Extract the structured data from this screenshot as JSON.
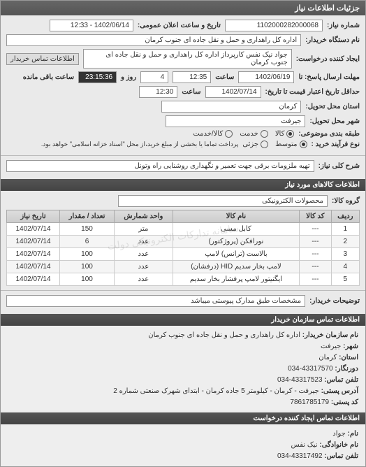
{
  "header": {
    "title": "جزئیات اطلاعات نیاز"
  },
  "top": {
    "reqNumLabel": "شماره نیاز:",
    "reqNum": "1102000282000068",
    "announceLabel": "تاریخ و ساعت اعلان عمومی:",
    "announceVal": "1402/06/14 - 12:33",
    "buyerLabel": "نام دستگاه خریدار:",
    "buyerVal": "اداره کل راهداری و حمل و نقل جاده ای جنوب کرمان",
    "creatorLabel": "ایجاد کننده درخواست:",
    "creatorVal": "جواد  نیک نفس کارپرداز اداره کل راهداری و حمل و نقل جاده ای جنوب کرمان",
    "contactBtn": "اطلاعات تماس خریدار",
    "deadlineSendLabel": "مهلت ارسال پاسخ: تا",
    "deadlineSendDate": "1402/06/19",
    "timeLabel1": "ساعت",
    "deadlineSendTime": "12:35",
    "daysLabel": "روز و",
    "daysVal": "4",
    "remainLabel": "ساعت باقی مانده",
    "remainVal": "23:15:36",
    "validityLabel": "حداقل تاریخ اعتبار قیمت تا تاریخ:",
    "validityDate": "1402/07/14",
    "timeLabel2": "ساعت",
    "validityTime": "12:30",
    "provinceLabel": "استان محل تحویل:",
    "provinceVal": "کرمان",
    "cityLabel": "شهر محل تحویل:",
    "cityVal": "جیرفت",
    "groupLabel": "طبقه بندی موضوعی:",
    "g1": "کالا",
    "g2": "خدمت",
    "g3": "کالا/خدمت",
    "buyTypeLabel": "نوع فرآیند خرید :",
    "b1": "متوسط",
    "b2": "جزئی",
    "buyNote": "پرداخت تماما یا بخشی از مبلغ خرید،از محل \"اسناد خزانه اسلامی\" خواهد بود."
  },
  "desc": {
    "label": "شرح کلی نیاز:",
    "val": "تهیه ملزومات برقی  جهت تعمیر و نگهداری روشنایی راه وتونل"
  },
  "goods": {
    "title": "اطلاعات کالاهای مورد نیاز",
    "groupLabel": "گروه کالا:",
    "groupVal": "محصولات الکترونیکی",
    "headers": [
      "ردیف",
      "کد کالا",
      "نام کالا",
      "واحد شمارش",
      "تعداد / مقدار",
      "تاریخ نیاز"
    ],
    "rows": [
      {
        "n": "1",
        "code": "---",
        "name": "کابل مسی",
        "unit": "متر",
        "qty": "150",
        "date": "1402/07/14"
      },
      {
        "n": "2",
        "code": "---",
        "name": "نورافکن (پروژکتور)",
        "unit": "عدد",
        "qty": "6",
        "date": "1402/07/14"
      },
      {
        "n": "3",
        "code": "---",
        "name": "بالاست (ترانس) لامپ",
        "unit": "عدد",
        "qty": "100",
        "date": "1402/07/14"
      },
      {
        "n": "4",
        "code": "---",
        "name": "لامپ بخار سدیم HID (درفشان)",
        "unit": "عدد",
        "qty": "100",
        "date": "1402/07/14"
      },
      {
        "n": "5",
        "code": "---",
        "name": "ایگنیتور لامپ پرفشار بخار سدیم",
        "unit": "عدد",
        "qty": "100",
        "date": "1402/07/14"
      }
    ]
  },
  "buyerNote": {
    "label": "توضیحات خریدار:",
    "val": "مشخصات طبق مدارک پیوستی میباشد"
  },
  "contact1": {
    "title": "اطلاعات تماس سازمان خریدار",
    "l1": "نام سازمان خریدار:",
    "v1": "اداره کل راهداری و حمل و نقل جاده ای جنوب کرمان",
    "l2": "شهر:",
    "v2": "جیرفت",
    "l3": "استان:",
    "v3": "کرمان",
    "l4": "دورنگار:",
    "v4": "43317570-034",
    "l5": "تلفن تماس:",
    "v5": "43317523-034",
    "l6": "آدرس پستی:",
    "v6": "جیرفت - کرمان - کیلومتر 5 جاده کرمان - ابتدای شهرک صنعتی شماره 2",
    "l7": "کد پستی:",
    "v7": "7861785179"
  },
  "contact2": {
    "title": "اطلاعات تماس ایجاد کننده درخواست",
    "l1": "نام:",
    "v1": "جواد",
    "l2": "نام خانوادگی:",
    "v2": "نیک نفس",
    "l3": "تلفن تماس:",
    "v3": "43317492-034"
  },
  "watermark": "سامانه تدارکات الکترونیکی دولت"
}
